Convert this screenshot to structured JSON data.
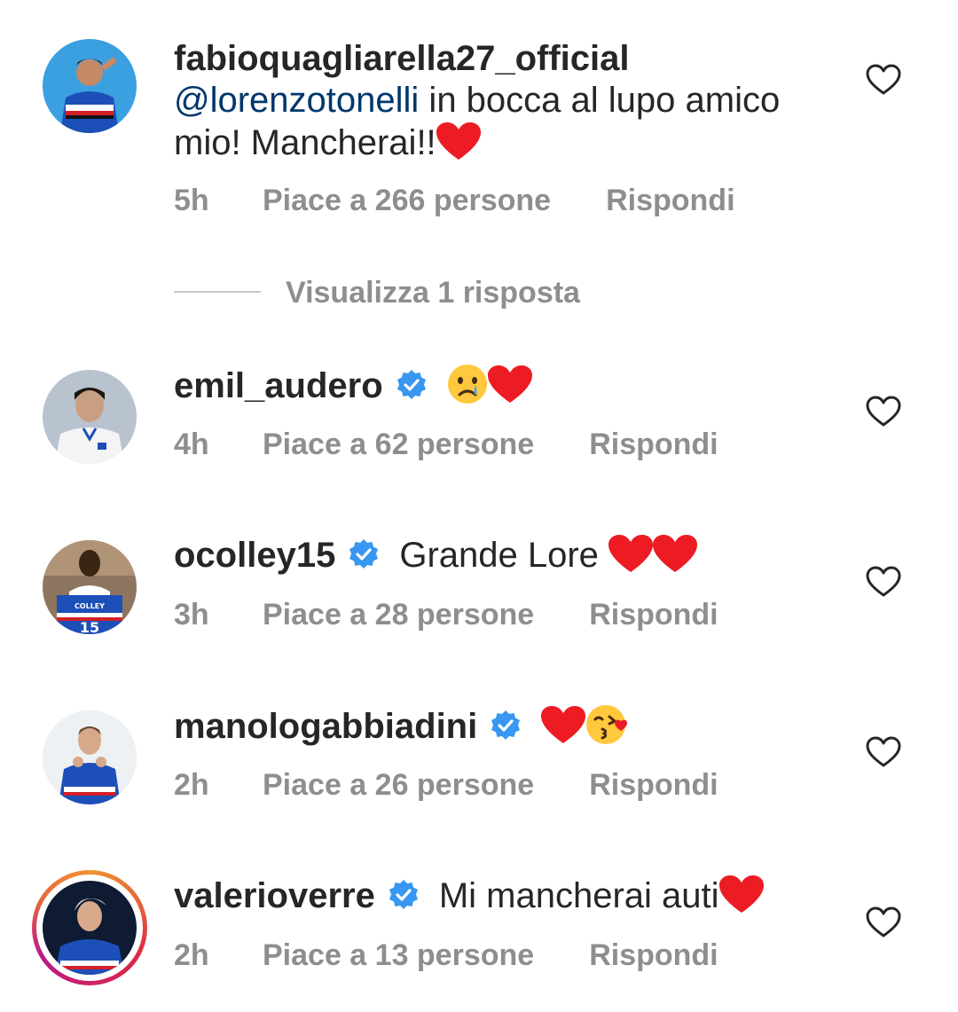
{
  "comments": [
    {
      "username": "fabioquagliarella27_official",
      "verified": false,
      "mention": "@lorenzotonelli",
      "text_line1": " in bocca al lupo amico",
      "text_line2": "mio! Mancherai!!",
      "emojis": [
        "red-heart"
      ],
      "time": "5h",
      "likes": "Piace a 266 persone",
      "reply": "Rispondi",
      "avatar": {
        "bg": "#3aa0e0",
        "shirt": "#1d4fb8"
      }
    },
    {
      "username": "emil_audero",
      "verified": true,
      "text": "",
      "emojis": [
        "crying-face",
        "red-heart"
      ],
      "time": "4h",
      "likes": "Piace a 62 persone",
      "reply": "Rispondi",
      "avatar": {
        "bg": "#b9c3cf",
        "shirt": "#f4f4f4"
      }
    },
    {
      "username": "ocolley15",
      "verified": true,
      "text": "Grande Lore ",
      "emojis": [
        "red-heart",
        "red-heart"
      ],
      "time": "3h",
      "likes": "Piace a 28 persone",
      "reply": "Rispondi",
      "avatar": {
        "bg": "#8d7560",
        "shirt": "#1d4fb8",
        "jersey_text": "COLLEY",
        "jersey_number": "15"
      }
    },
    {
      "username": "manologabbiadini",
      "verified": true,
      "text": "",
      "emojis": [
        "red-heart",
        "kissing-face"
      ],
      "time": "2h",
      "likes": "Piace a 26 persone",
      "reply": "Rispondi",
      "avatar": {
        "bg": "#eef1f4",
        "shirt": "#1d4fb8"
      }
    },
    {
      "username": "valerioverre",
      "verified": true,
      "text": "Mi mancherai auti",
      "emojis": [
        "red-heart"
      ],
      "time": "2h",
      "likes": "Piace a 13 persone",
      "reply": "Rispondi",
      "story": true,
      "avatar": {
        "bg": "#0e1b33",
        "shirt": "#1d4fb8"
      }
    }
  ],
  "view_replies_label": "Visualizza 1 risposta",
  "colors": {
    "mention": "#00376b",
    "secondary_text": "#8e8e8e",
    "verified_badge": "#3897f0",
    "heart": "#ed1c24"
  },
  "icons": [
    "heart-outline-icon",
    "verified-badge-icon",
    "red-heart-emoji",
    "crying-face-emoji",
    "kissing-face-emoji"
  ]
}
